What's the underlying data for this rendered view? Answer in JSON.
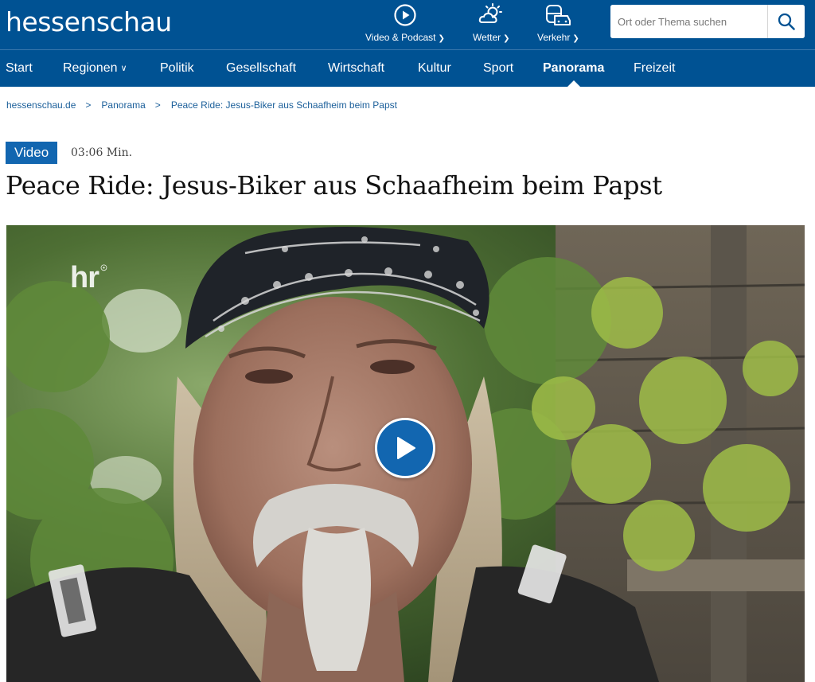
{
  "header": {
    "logo": "hessenschau",
    "tools": [
      {
        "label": "Video & Podcast",
        "icon": "play-circle-icon"
      },
      {
        "label": "Wetter",
        "icon": "weather-icon"
      },
      {
        "label": "Verkehr",
        "icon": "traffic-icon"
      }
    ],
    "search": {
      "placeholder": "Ort oder Thema suchen",
      "icon": "search-icon"
    }
  },
  "nav": {
    "items": [
      {
        "label": "Start"
      },
      {
        "label": "Regionen",
        "has_dropdown": true
      },
      {
        "label": "Politik"
      },
      {
        "label": "Gesellschaft"
      },
      {
        "label": "Wirtschaft"
      },
      {
        "label": "Kultur"
      },
      {
        "label": "Sport"
      },
      {
        "label": "Panorama",
        "active": true
      },
      {
        "label": "Freizeit"
      }
    ]
  },
  "breadcrumb": {
    "items": [
      "hessenschau.de",
      "Panorama",
      "Peace Ride: Jesus-Biker aus Schaafheim beim Papst"
    ],
    "separator": ">"
  },
  "article": {
    "badge": "Video",
    "duration": "03:06 Min.",
    "title": "Peace Ride: Jesus-Biker aus Schaafheim beim Papst"
  },
  "video": {
    "watermark": "hr",
    "play_icon": "play-icon"
  },
  "colors": {
    "brand_blue": "#005293",
    "badge_blue": "#1266b0",
    "link_blue": "#1b5f9a"
  }
}
